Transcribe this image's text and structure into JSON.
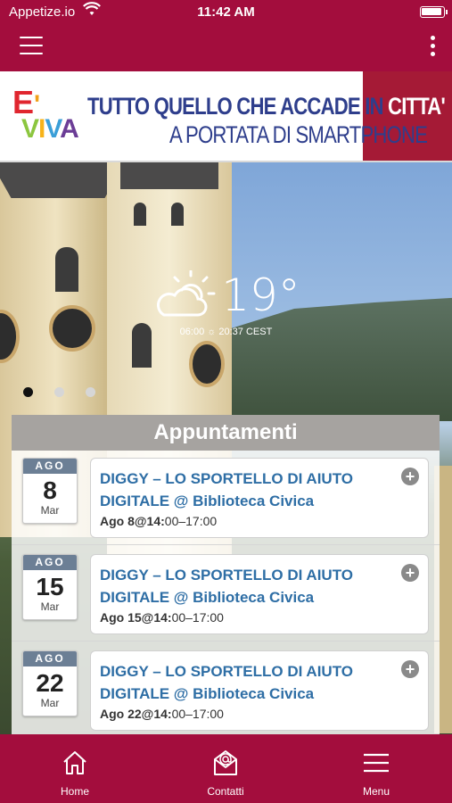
{
  "status_bar": {
    "carrier": "Appetize.io",
    "time": "11:42 AM"
  },
  "banner": {
    "logo_top": "E",
    "logo_apostrophe": "'",
    "logo_bottom": "VIVA",
    "line1_main": "TUTTO QUELLO CHE ACCADE IN ",
    "line1_accent": "CITTA'",
    "line2": "A PORTATA DI SMARTPHONE"
  },
  "weather": {
    "icon": "partly-cloudy-icon",
    "temperature": "19°",
    "sun_times": "06:00 ☼ 20:37 CEST"
  },
  "carousel": {
    "dots": 3,
    "active_index": 0
  },
  "appointments": {
    "title": "Appuntamenti",
    "items": [
      {
        "month": "AGO",
        "day": "8",
        "weekday": "Mar",
        "title": "DIGGY – LO SPORTELLO DI AIUTO DIGITALE @ Biblioteca Civica",
        "when_bold": "Ago 8@14:",
        "when_rest": "00–17:00"
      },
      {
        "month": "AGO",
        "day": "15",
        "weekday": "Mar",
        "title": "DIGGY – LO SPORTELLO DI AIUTO DIGITALE @ Biblioteca Civica",
        "when_bold": "Ago 15@14:",
        "when_rest": "00–17:00"
      },
      {
        "month": "AGO",
        "day": "22",
        "weekday": "Mar",
        "title": "DIGGY – LO SPORTELLO DI AIUTO DIGITALE @ Biblioteca Civica",
        "when_bold": "Ago 22@14:",
        "when_rest": "00–17:00"
      }
    ]
  },
  "tabbar": {
    "home": "Home",
    "contacts": "Contatti",
    "menu": "Menu"
  },
  "colors": {
    "brand": "#a30d3d",
    "link": "#2e6ea5"
  }
}
